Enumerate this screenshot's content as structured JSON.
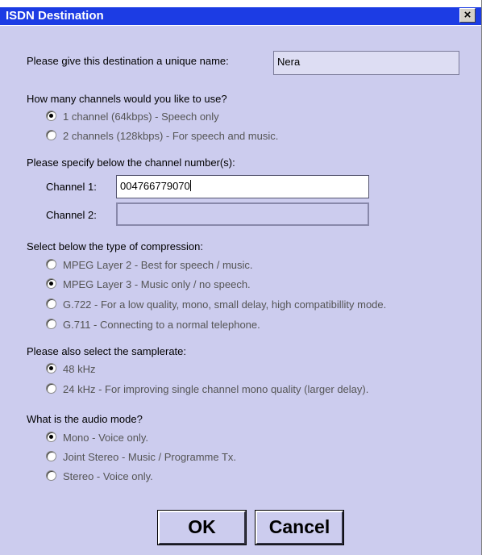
{
  "window": {
    "title": "ISDN Destination",
    "close_glyph": "×"
  },
  "name": {
    "prompt": "Please give this destination a unique name:",
    "value": "Nera"
  },
  "channels": {
    "question": "How many channels would you like to use?",
    "options": [
      {
        "label": "1 channel (64kbps) - Speech only",
        "selected": true
      },
      {
        "label": "2 channels (128kbps) - For speech and music.",
        "selected": false
      }
    ]
  },
  "numbers": {
    "instruction": "Please specify below the channel number(s):",
    "channel1": {
      "label": "Channel 1:",
      "value": "004766779070"
    },
    "channel2": {
      "label": "Channel 2:",
      "value": ""
    }
  },
  "compression": {
    "question": "Select below the type of compression:",
    "options": [
      {
        "label": "MPEG Layer 2 - Best for speech / music.",
        "selected": false
      },
      {
        "label": "MPEG Layer 3 - Music only / no speech.",
        "selected": true
      },
      {
        "label": "G.722 - For a low quality, mono, small delay, high compatibillity mode.",
        "selected": false
      },
      {
        "label": "G.711 - Connecting to a normal telephone.",
        "selected": false
      }
    ]
  },
  "samplerate": {
    "question": "Please also select the samplerate:",
    "options": [
      {
        "label": "48 kHz",
        "selected": true
      },
      {
        "label": "24 kHz - For improving single channel mono quality (larger delay).",
        "selected": false
      }
    ]
  },
  "audiomode": {
    "question": "What is the audio mode?",
    "options": [
      {
        "label": "Mono - Voice only.",
        "selected": true
      },
      {
        "label": "Joint Stereo - Music / Programme Tx.",
        "selected": false
      },
      {
        "label": "Stereo - Voice only.",
        "selected": false
      }
    ]
  },
  "buttons": {
    "ok": "OK",
    "cancel": "Cancel"
  },
  "colors": {
    "dialog_bg": "#ccccee",
    "title_bar": "#1c3ce4"
  }
}
